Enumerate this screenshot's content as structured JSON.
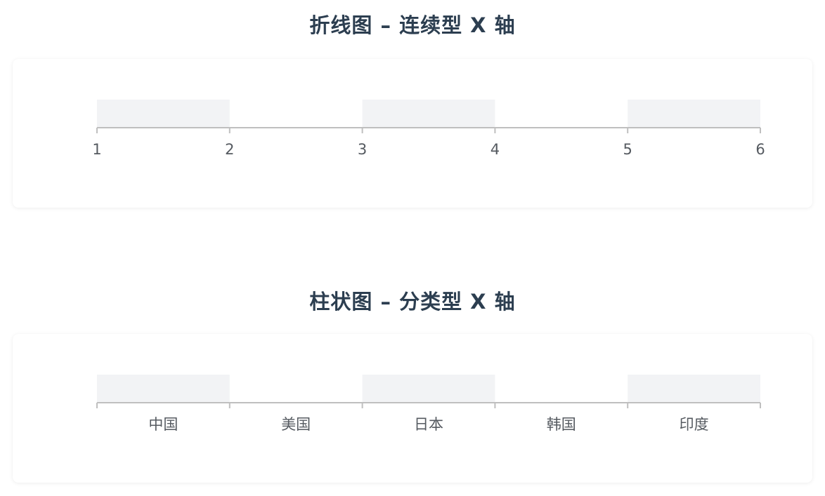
{
  "charts": [
    {
      "title": "折线图 – 连续型 X 轴"
    },
    {
      "title": "柱状图 – 分类型 X 轴"
    }
  ],
  "chart_data": [
    {
      "type": "line",
      "title": "折线图 – 连续型 X 轴",
      "axis_type": "value",
      "x_ticks": [
        "1",
        "2",
        "3",
        "4",
        "5",
        "6"
      ],
      "xlim": [
        1,
        6
      ],
      "series": [],
      "split_area": "alternating bands",
      "colors": {
        "axis": "#bfbfbf",
        "band": "#f2f3f5",
        "label": "#555a60",
        "title": "#2c3e50"
      }
    },
    {
      "type": "bar",
      "title": "柱状图 – 分类型 X 轴",
      "axis_type": "category",
      "categories": [
        "中国",
        "美国",
        "日本",
        "韩国",
        "印度"
      ],
      "series": [],
      "split_area": "alternating bands",
      "colors": {
        "axis": "#bfbfbf",
        "band": "#f2f3f5",
        "label": "#555a60",
        "title": "#2c3e50"
      }
    }
  ]
}
